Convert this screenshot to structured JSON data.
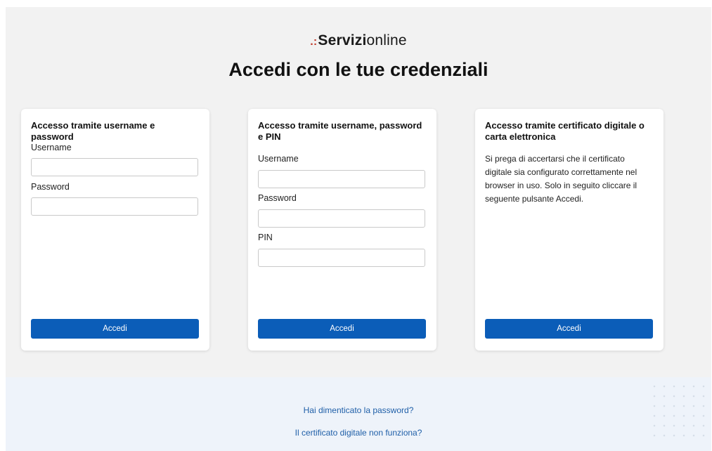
{
  "header": {
    "brand_bold": "Servizi",
    "brand_regular": "online",
    "title": "Accedi con le tue credenziali"
  },
  "cards": [
    {
      "title": "Accesso tramite username e password",
      "username_label": "Username",
      "password_label": "Password",
      "button_label": "Accedi"
    },
    {
      "title": "Accesso tramite username, password e PIN",
      "username_label": "Username",
      "password_label": "Password",
      "pin_label": "PIN",
      "button_label": "Accedi"
    },
    {
      "title": "Accesso tramite certificato digitale o carta elettronica",
      "text": "Si prega di accertarsi che il certificato digitale sia configurato correttamente nel browser in uso. Solo in seguito cliccare il seguente pulsante Accedi.",
      "button_label": "Accedi"
    }
  ],
  "footer": {
    "forgot_password": "Hai dimenticato la password?",
    "certificate_issue": "Il certificato digitale non funziona?"
  },
  "colors": {
    "primary_button": "#0b5db8",
    "link": "#1f5fa8",
    "brand_accent": "#c0392b"
  }
}
